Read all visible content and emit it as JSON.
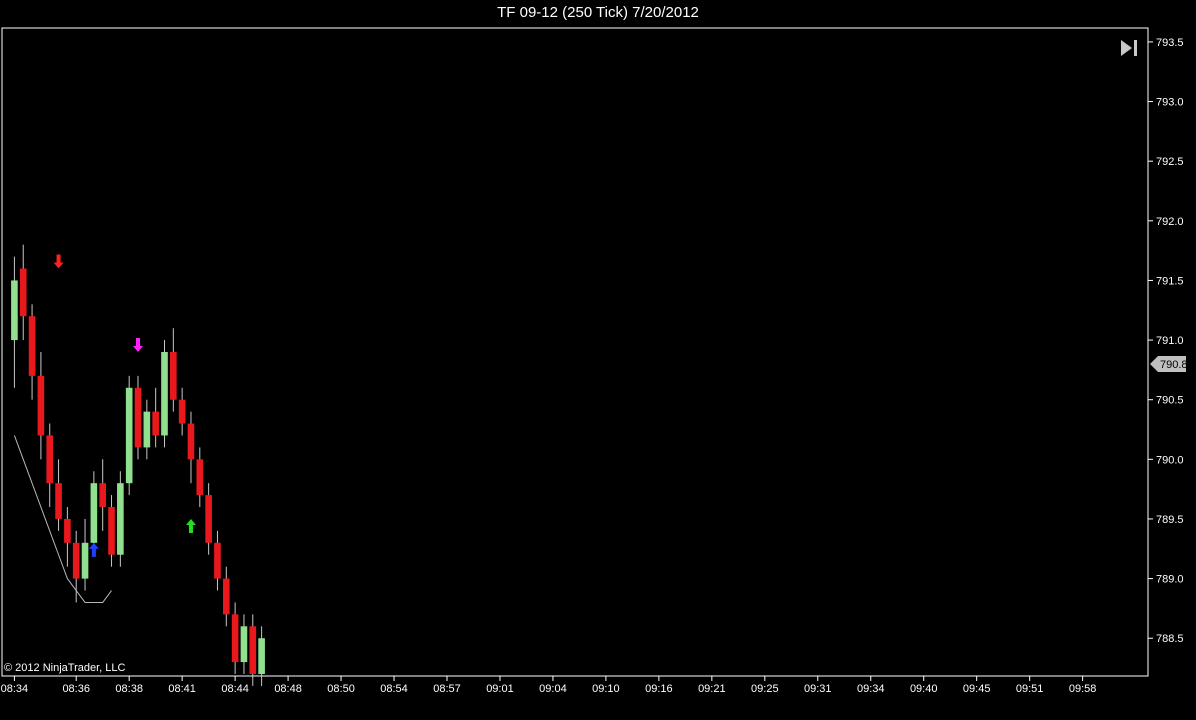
{
  "header": {
    "title": "TF 09-12 (250 Tick)  7/20/2012"
  },
  "copyright": "© 2012 NinjaTrader, LLC",
  "price_tag": "790.8",
  "colors": {
    "background": "#000000",
    "up_candle": "#90E090",
    "down_candle": "#E8181C",
    "wick": "#C8C8C8",
    "sma": "#B8B8B8",
    "axis": "#FFFFFF",
    "marker_red": "#FF2020",
    "marker_magenta": "#FF20FF",
    "marker_blue": "#2040FF",
    "marker_green": "#20E020",
    "trend_line_green": "#30E080",
    "trend_line_red": "#FF3030"
  },
  "chart_data": {
    "type": "candlestick",
    "title": "TF 09-12 (250 Tick)  7/20/2012",
    "xlabel": "",
    "ylabel": "",
    "ylim": [
      788.2,
      793.6
    ],
    "grid": false,
    "y_ticks": [
      788.5,
      789.0,
      789.5,
      790.0,
      790.5,
      791.0,
      791.5,
      792.0,
      792.5,
      793.0,
      793.5
    ],
    "y_tick_labels": [
      "788.5",
      "789.0",
      "789.5",
      "790.0",
      "790.5",
      "791.0",
      "791.5",
      "792.0",
      "792.5",
      "793.0",
      "793.5"
    ],
    "x_tick_labels": [
      {
        "label": "08:34",
        "bar": 0
      },
      {
        "label": "08:36",
        "bar": 7
      },
      {
        "label": "08:38",
        "bar": 13
      },
      {
        "label": "08:41",
        "bar": 19
      },
      {
        "label": "08:44",
        "bar": 25
      },
      {
        "label": "08:48",
        "bar": 31
      },
      {
        "label": "08:50",
        "bar": 37
      },
      {
        "label": "08:54",
        "bar": 43
      },
      {
        "label": "08:57",
        "bar": 49
      },
      {
        "label": "09:01",
        "bar": 55
      },
      {
        "label": "09:04",
        "bar": 61
      },
      {
        "label": "09:10",
        "bar": 67
      },
      {
        "label": "09:16",
        "bar": 73
      },
      {
        "label": "09:21",
        "bar": 79
      },
      {
        "label": "09:25",
        "bar": 85
      },
      {
        "label": "09:31",
        "bar": 91
      },
      {
        "label": "09:34",
        "bar": 97
      },
      {
        "label": "09:40",
        "bar": 103
      },
      {
        "label": "09:45",
        "bar": 109
      },
      {
        "label": "09:51",
        "bar": 115
      },
      {
        "label": "09:58",
        "bar": 121
      }
    ],
    "candles": [
      [
        791.0,
        791.5,
        791.7,
        790.6
      ],
      [
        791.6,
        791.2,
        791.8,
        791.0
      ],
      [
        791.2,
        790.7,
        791.3,
        790.5
      ],
      [
        790.7,
        790.2,
        790.9,
        790.0
      ],
      [
        790.2,
        789.8,
        790.3,
        789.6
      ],
      [
        789.8,
        789.5,
        790.0,
        789.4
      ],
      [
        789.5,
        789.3,
        789.6,
        789.1
      ],
      [
        789.3,
        789.0,
        789.4,
        788.8
      ],
      [
        789.0,
        789.3,
        789.5,
        788.9
      ],
      [
        789.3,
        789.8,
        789.9,
        789.2
      ],
      [
        789.8,
        789.6,
        790.0,
        789.4
      ],
      [
        789.6,
        789.2,
        789.7,
        789.1
      ],
      [
        789.2,
        789.8,
        789.9,
        789.1
      ],
      [
        789.8,
        790.6,
        790.7,
        789.7
      ],
      [
        790.6,
        790.1,
        790.7,
        790.0
      ],
      [
        790.1,
        790.4,
        790.5,
        790.0
      ],
      [
        790.4,
        790.2,
        790.6,
        790.1
      ],
      [
        790.2,
        790.9,
        791.0,
        790.1
      ],
      [
        790.9,
        790.5,
        791.1,
        790.4
      ],
      [
        790.5,
        790.3,
        790.6,
        790.2
      ],
      [
        790.3,
        790.0,
        790.4,
        789.8
      ],
      [
        790.0,
        789.7,
        790.1,
        789.6
      ],
      [
        789.7,
        789.3,
        789.8,
        789.2
      ],
      [
        789.3,
        789.0,
        789.4,
        788.9
      ],
      [
        789.0,
        788.7,
        789.1,
        788.6
      ],
      [
        788.7,
        788.3,
        788.8,
        788.2
      ],
      [
        788.3,
        788.6,
        788.7,
        788.2
      ],
      [
        788.6,
        788.2,
        788.7,
        788.1
      ],
      [
        788.2,
        788.5,
        788.6,
        788.1
      ]
    ],
    "sma_values": [
      790.2,
      790.0,
      789.8,
      789.6,
      789.4,
      789.2,
      789.0,
      788.9,
      788.8,
      788.8,
      788.8,
      788.9
    ],
    "signal_markers": [
      {
        "bar": 5,
        "price": 791.6,
        "dir": "down",
        "color": "marker_red"
      },
      {
        "bar": 9,
        "price": 789.3,
        "dir": "up",
        "color": "marker_blue"
      },
      {
        "bar": 14,
        "price": 790.9,
        "dir": "down",
        "color": "marker_magenta"
      },
      {
        "bar": 20,
        "price": 789.5,
        "dir": "up",
        "color": "marker_green"
      }
    ]
  }
}
